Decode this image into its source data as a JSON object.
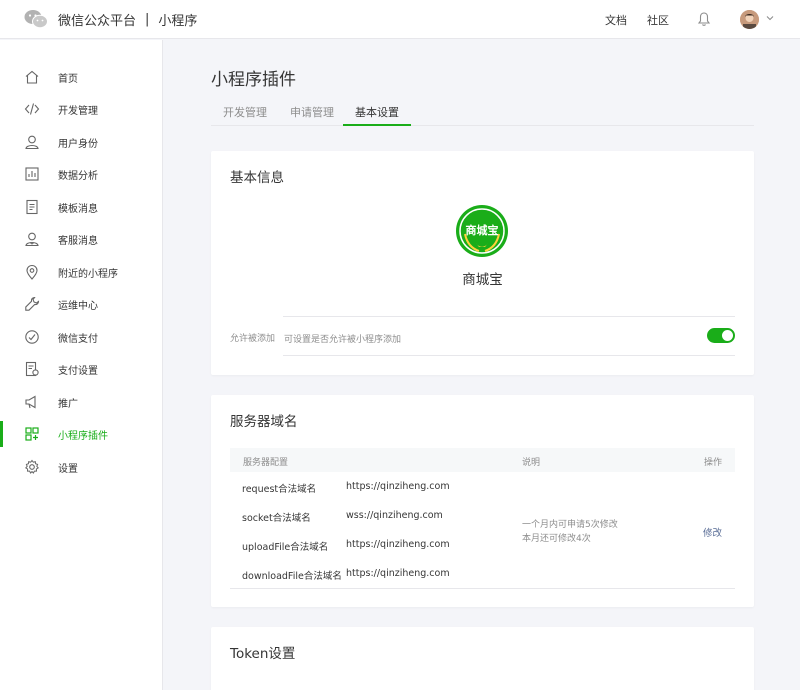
{
  "header": {
    "brand": "微信公众平台",
    "separator": "|",
    "product": "小程序",
    "links": [
      "文档",
      "社区"
    ]
  },
  "sidebar": {
    "items": [
      {
        "label": "首页",
        "icon": "home-icon"
      },
      {
        "label": "开发管理",
        "icon": "code-icon"
      },
      {
        "label": "用户身份",
        "icon": "user-icon"
      },
      {
        "label": "数据分析",
        "icon": "chart-icon"
      },
      {
        "label": "模板消息",
        "icon": "document-icon"
      },
      {
        "label": "客服消息",
        "icon": "service-icon"
      },
      {
        "label": "附近的小程序",
        "icon": "location-icon"
      },
      {
        "label": "运维中心",
        "icon": "wrench-icon"
      },
      {
        "label": "微信支付",
        "icon": "pay-icon"
      },
      {
        "label": "支付设置",
        "icon": "pay-settings-icon"
      },
      {
        "label": "推广",
        "icon": "megaphone-icon"
      },
      {
        "label": "小程序插件",
        "icon": "plugin-grid-icon",
        "active": true
      },
      {
        "label": "设置",
        "icon": "gear-icon"
      }
    ]
  },
  "page": {
    "title": "小程序插件",
    "tabs": [
      "开发管理",
      "申请管理",
      "基本设置"
    ],
    "active_tab": "基本设置"
  },
  "basic_info": {
    "title": "基本信息",
    "logo_text": "商城宝",
    "name": "商城宝",
    "toggle_label": "允许被添加",
    "toggle_desc": "可设置是否允许被小程序添加",
    "toggle_on": true
  },
  "server_domain": {
    "title": "服务器域名",
    "headers": [
      "服务器配置",
      "说明",
      "操作"
    ],
    "rows": [
      {
        "name": "request合法域名",
        "value": "https://qinziheng.com"
      },
      {
        "name": "socket合法域名",
        "value": "wss://qinziheng.com"
      },
      {
        "name": "uploadFile合法域名",
        "value": "https://qinziheng.com"
      },
      {
        "name": "downloadFile合法域名",
        "value": "https://qinziheng.com"
      }
    ],
    "note_line1": "一个月内可申请5次修改",
    "note_line2": "本月还可修改4次",
    "action": "修改"
  },
  "token": {
    "title": "Token设置"
  },
  "colors": {
    "accent": "#1aad19",
    "link": "#576b95",
    "text": "#353535",
    "muted": "#8d8d8d",
    "background": "#f4f5f9"
  }
}
